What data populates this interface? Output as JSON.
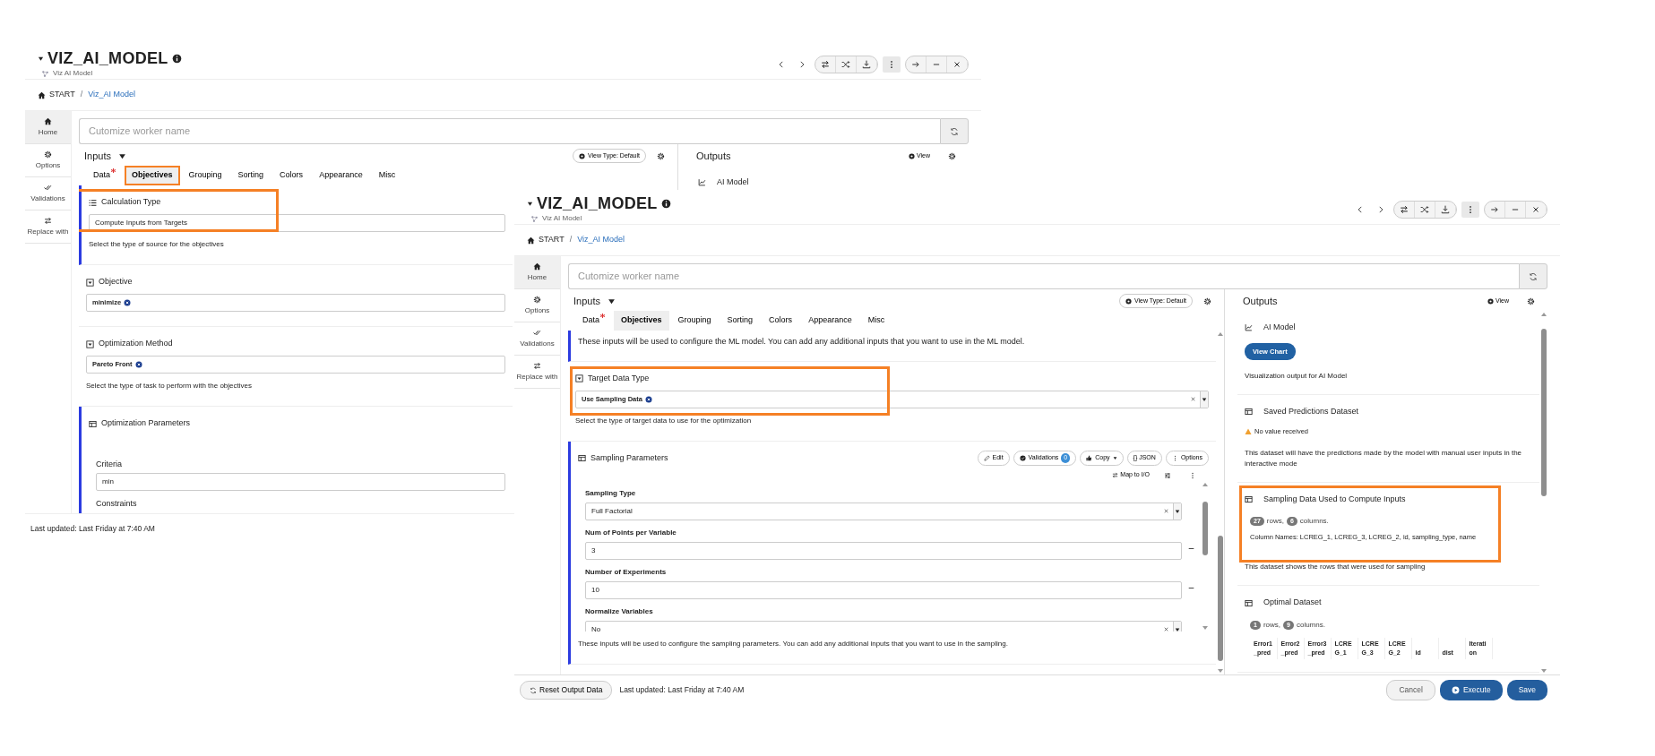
{
  "windows": [
    {
      "title": "VIZ_AI_MODEL",
      "subtitle": "Viz AI Model",
      "breadcrumb": {
        "items": [
          "START",
          "Viz_AI Model"
        ],
        "separator": "/"
      },
      "sidebar": [
        {
          "label": "Home",
          "selected": true
        },
        {
          "label": "Options",
          "selected": false
        },
        {
          "label": "Validations",
          "selected": false
        },
        {
          "label": "Replace with",
          "selected": false
        }
      ],
      "worker_name": {
        "placeholder": "Cutomize worker name"
      },
      "inputs": {
        "title": "Inputs",
        "view_type": "View Type: Default",
        "tabs": [
          {
            "label": "Data",
            "required": true,
            "selected": false,
            "highlighted": false
          },
          {
            "label": "Objectives",
            "required": false,
            "selected": true,
            "highlighted": true
          },
          {
            "label": "Grouping",
            "required": false,
            "selected": false,
            "highlighted": false
          },
          {
            "label": "Sorting",
            "required": false,
            "selected": false,
            "highlighted": false
          },
          {
            "label": "Colors",
            "required": false,
            "selected": false,
            "highlighted": false
          },
          {
            "label": "Appearance",
            "required": false,
            "selected": false,
            "highlighted": false
          },
          {
            "label": "Misc",
            "required": false,
            "selected": false,
            "highlighted": false
          }
        ],
        "blocks": [
          {
            "kind": "field",
            "title": "Calculation Type",
            "field": {
              "kind": "text",
              "value": "Compute Inputs from Targets"
            },
            "helper": "Select the type of source for the objectives",
            "highlighted": true
          },
          {
            "kind": "field",
            "title": "Objective",
            "field": {
              "kind": "tag",
              "value": "minimize"
            }
          },
          {
            "kind": "field",
            "title": "Optimization Method",
            "field": {
              "kind": "tag",
              "value": "Pareto Front"
            },
            "helper": "Select the type of task to perform with the objectives"
          },
          {
            "kind": "group",
            "title": "Optimization Parameters",
            "fields": [
              {
                "kind": "text",
                "label": "Criteria",
                "value": "min"
              },
              {
                "kind": "table",
                "label": "Constraints"
              }
            ]
          }
        ]
      },
      "outputs": {
        "title": "Outputs",
        "view": "View",
        "items": [
          {
            "kind": "chart",
            "title": "AI Model"
          }
        ]
      },
      "footer": {
        "updated": "Last updated: Last Friday at 7:40 AM"
      }
    },
    {
      "title": "VIZ_AI_MODEL",
      "subtitle": "Viz AI Model",
      "breadcrumb": {
        "items": [
          "START",
          "Viz_AI Model"
        ],
        "separator": "/"
      },
      "sidebar": [
        {
          "label": "Home",
          "selected": true
        },
        {
          "label": "Options",
          "selected": false
        },
        {
          "label": "Validations",
          "selected": false
        },
        {
          "label": "Replace with",
          "selected": false
        }
      ],
      "worker_name": {
        "placeholder": "Cutomize worker name"
      },
      "inputs": {
        "title": "Inputs",
        "view_type": "View Type: Default",
        "tabs": [
          {
            "label": "Data",
            "required": true,
            "selected": false,
            "highlighted": false
          },
          {
            "label": "Objectives",
            "required": false,
            "selected": true,
            "highlighted": false
          },
          {
            "label": "Grouping",
            "required": false,
            "selected": false,
            "highlighted": false
          },
          {
            "label": "Sorting",
            "required": false,
            "selected": false,
            "highlighted": false
          },
          {
            "label": "Colors",
            "required": false,
            "selected": false,
            "highlighted": false
          },
          {
            "label": "Appearance",
            "required": false,
            "selected": false,
            "highlighted": false
          },
          {
            "label": "Misc",
            "required": false,
            "selected": false,
            "highlighted": false
          }
        ],
        "blocks": [
          {
            "kind": "note",
            "text": "These inputs will be used to configure the ML model. You can add any additional inputs that you want to use in the ML model."
          },
          {
            "kind": "field",
            "title": "Target Data Type",
            "field": {
              "kind": "tag",
              "value": "Use Sampling Data",
              "clearable": true
            },
            "helper": "Select the type of target data to use for the optimization",
            "highlighted": true
          },
          {
            "kind": "group",
            "title": "Sampling Parameters",
            "actions": [
              {
                "kind": "edit",
                "label": "Edit"
              },
              {
                "kind": "validations",
                "label": "Validations",
                "badge": "0"
              },
              {
                "kind": "copy",
                "label": "Copy"
              },
              {
                "kind": "plain",
                "label": "{} JSON"
              },
              {
                "kind": "options",
                "label": "Options"
              }
            ],
            "map": "Map to I/O",
            "fields": [
              {
                "kind": "text",
                "label": "Sampling Type",
                "value": "Full Factorial",
                "clearable": true
              },
              {
                "kind": "number",
                "label": "Num of Points per Variable",
                "value": "3"
              },
              {
                "kind": "number",
                "label": "Number of Experiments",
                "value": "10"
              },
              {
                "kind": "text",
                "label": "Normalize Variables",
                "value": "No",
                "clearable": true
              }
            ],
            "helper": "These inputs will be used to configure the sampling parameters. You can add any additional inputs that you want to use in the sampling."
          }
        ]
      },
      "outputs": {
        "title": "Outputs",
        "view": "View",
        "items": [
          {
            "kind": "chart",
            "title": "AI Model",
            "button": "View Chart",
            "description": "Visualization output for AI Model"
          },
          {
            "kind": "dataset",
            "title": "Saved Predictions Dataset",
            "warning": "No value received",
            "description": "This dataset will have the predictions made by the model with manual user inputs in the interactive mode"
          },
          {
            "kind": "dataset",
            "title": "Sampling Data Used to Compute Inputs",
            "rows": "27",
            "rows_label": "rows,",
            "columns": "6",
            "columns_label": "columns.",
            "column_names": "Column Names: LCREG_1, LCREG_3, LCREG_2, id, sampling_type, name",
            "description": "This dataset shows the rows that were used for sampling",
            "highlighted": true
          },
          {
            "kind": "dataset",
            "title": "Optimal Dataset",
            "rows": "1",
            "rows_label": "rows,",
            "columns": "9",
            "columns_label": "columns.",
            "table_columns": [
              "Error1_pred",
              "Error2_pred",
              "Error3_pred",
              "LCREG_1",
              "LCREG_3",
              "LCREG_2",
              "id",
              "dist",
              "Iteration"
            ]
          }
        ]
      },
      "footer": {
        "reset": "Reset Output Data",
        "updated": "Last updated: Last Friday at 7:40 AM",
        "cancel": "Cancel",
        "execute": "Execute",
        "save": "Save"
      }
    }
  ]
}
